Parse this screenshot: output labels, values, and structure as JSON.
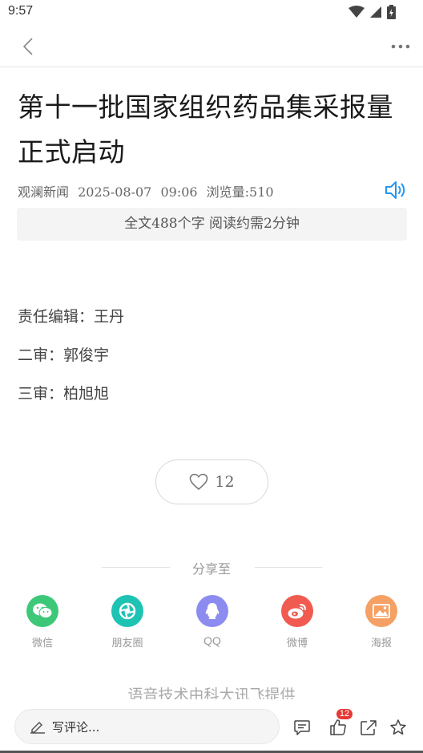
{
  "status_bar": {
    "time": "9:57"
  },
  "article": {
    "title": "第十一批国家组织药品集采报量正式启动",
    "source": "观澜新闻",
    "date": "2025-08-07",
    "time": "09:06",
    "views": "浏览量:510",
    "read_info": "全文488个字 阅读约需2分钟",
    "credits": [
      "责任编辑：王丹",
      "二审：郭俊宇",
      "三审：柏旭旭"
    ]
  },
  "like": {
    "count": "12"
  },
  "share": {
    "title": "分享至",
    "items": [
      {
        "label": "微信",
        "icon": "wechat-icon",
        "color": "#3cc878"
      },
      {
        "label": "朋友圈",
        "icon": "moments-icon",
        "color": "#1ec3b4"
      },
      {
        "label": "QQ",
        "icon": "qq-icon",
        "color": "#8c8cf0"
      },
      {
        "label": "微博",
        "icon": "weibo-icon",
        "color": "#f05a50"
      },
      {
        "label": "海报",
        "icon": "poster-icon",
        "color": "#f5a064"
      }
    ]
  },
  "provider": "语音技术由科大讯飞提供",
  "bottom_bar": {
    "comment_placeholder": "写评论...",
    "like_badge": "12"
  },
  "colors": {
    "accent_blue": "#2196f3",
    "badge_red": "#e53935"
  }
}
